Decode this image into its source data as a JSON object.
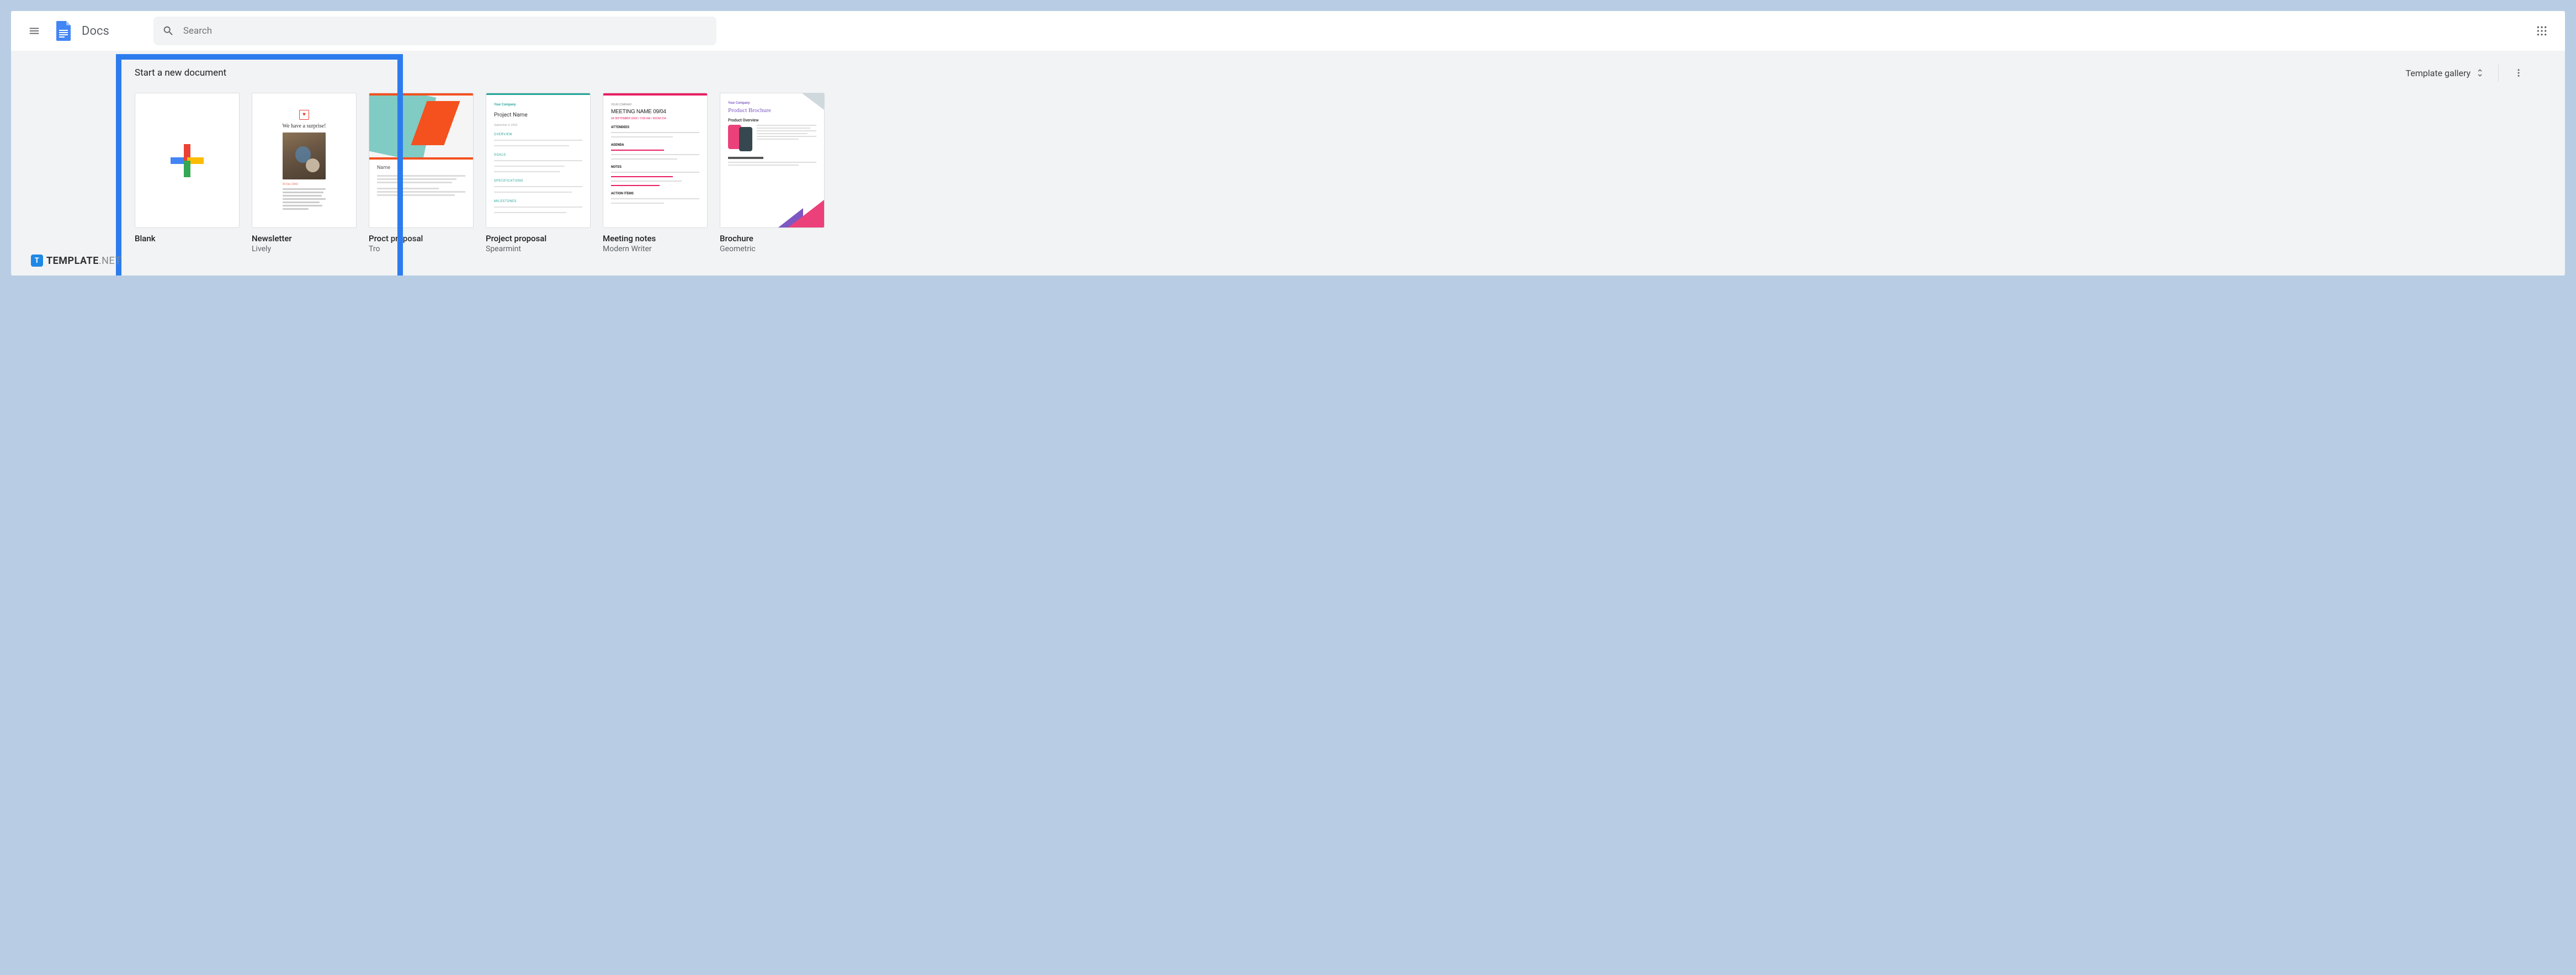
{
  "header": {
    "app_title": "Docs",
    "search_placeholder": "Search"
  },
  "template_section": {
    "title": "Start a new document",
    "gallery_label": "Template gallery"
  },
  "templates": [
    {
      "name": "Blank",
      "sub": ""
    },
    {
      "name": "Newsletter",
      "sub": "Lively"
    },
    {
      "name": "Project proposal",
      "sub": "Tropic",
      "name_clip": "Pro",
      "sub_clip": "Tro",
      "name_body": "ct proposal"
    },
    {
      "name": "Project proposal",
      "sub": "Spearmint"
    },
    {
      "name": "Meeting notes",
      "sub": "Modern Writer"
    },
    {
      "name": "Brochure",
      "sub": "Geometric"
    }
  ],
  "thumbs": {
    "newsletter_headline": "We have a surprise!",
    "proj_body_title": "Name",
    "spear_company": "Your Company",
    "spear_title": "Project Name",
    "spear_date": "September 4, 20XX",
    "spear_sec_overview": "OVERVIEW",
    "spear_sec_goals": "GOALS",
    "spear_sec_specs": "SPECIFICATIONS",
    "spear_sec_milestones": "MILESTONES",
    "meeting_company": "YOUR COMPANY",
    "meeting_title": "MEETING NAME 09/04",
    "meeting_date": "04 SEPTEMBER 20XX / 9:00 AM / ROOM 234",
    "meeting_attendees": "ATTENDEES",
    "meeting_agenda": "AGENDA",
    "meeting_notes": "NOTES",
    "meeting_actions": "ACTION ITEMS",
    "brochure_company": "Your Company",
    "brochure_title": "Product Brochure",
    "brochure_section": "Product Overview"
  },
  "watermark": {
    "badge": "T",
    "text": "TEMPLATE",
    "suffix": ".NET"
  }
}
